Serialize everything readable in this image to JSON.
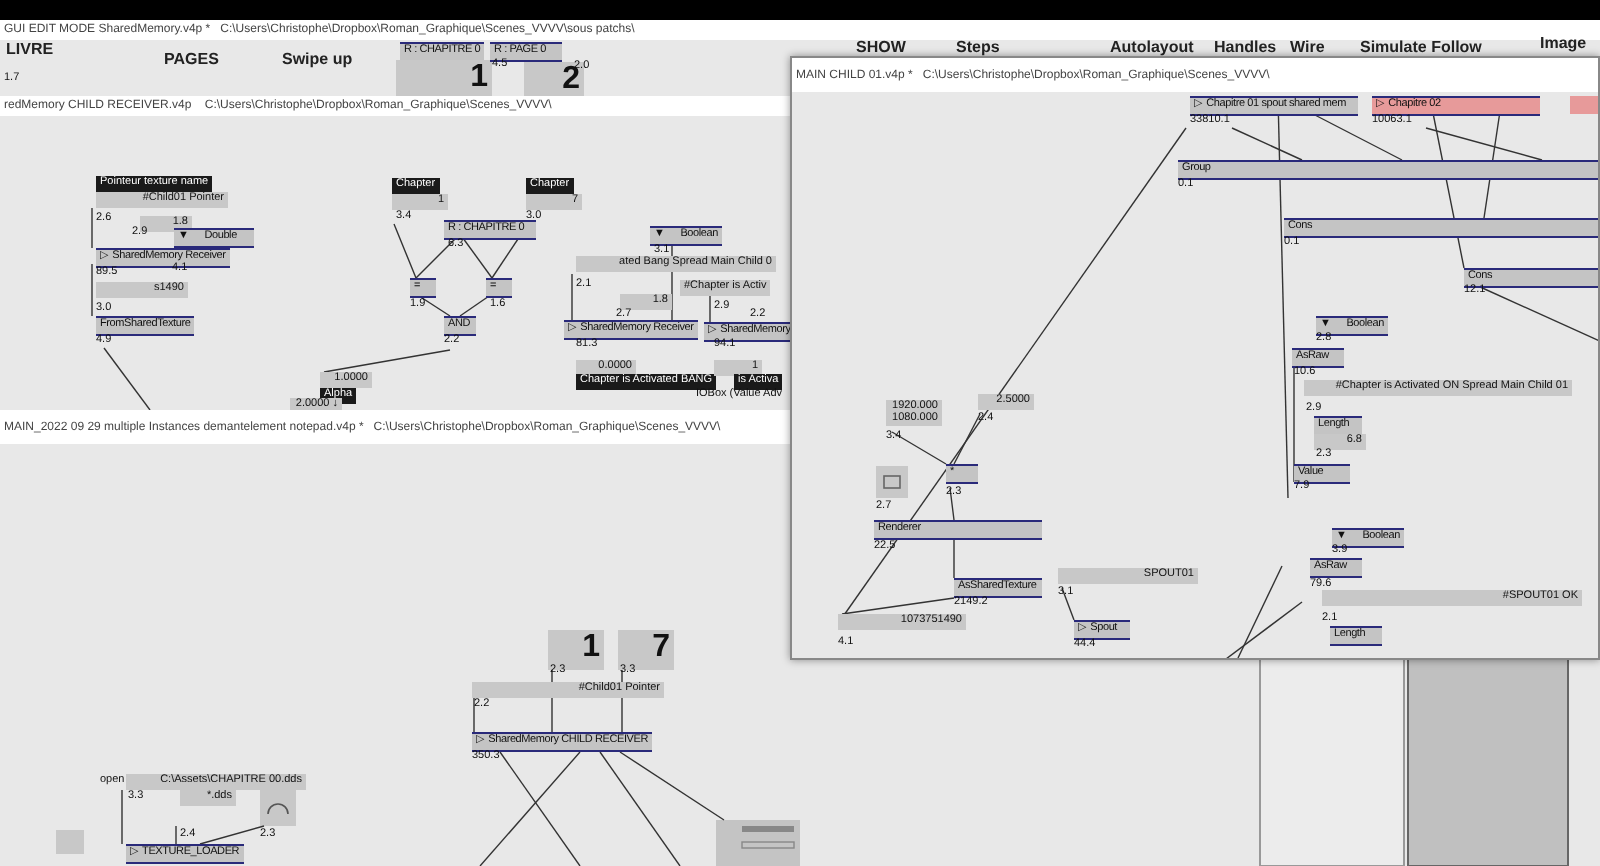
{
  "windows": [
    {
      "title": "GUI EDIT MODE SharedMemory.v4p *   C:\\Users\\Christophe\\Dropbox\\Roman_Graphique\\Scenes_VVVV\\sous patchs\\",
      "items": [
        {
          "kind": "button",
          "text": "LIVRE"
        },
        {
          "kind": "button",
          "text": "PAGES"
        },
        {
          "kind": "button",
          "text": "Swipe up"
        },
        {
          "kind": "node",
          "text": "R : CHAPITRE 0"
        },
        {
          "kind": "big",
          "text": "1"
        },
        {
          "kind": "node",
          "text": "R : PAGE 0"
        },
        {
          "kind": "value",
          "text": "4.5"
        },
        {
          "kind": "big",
          "text": "2"
        },
        {
          "kind": "value",
          "text": "2.0"
        },
        {
          "kind": "value",
          "text": "1.7"
        },
        {
          "kind": "button",
          "text": "SHOW"
        },
        {
          "kind": "button",
          "text": "Steps"
        },
        {
          "kind": "button",
          "text": "Autolayout"
        },
        {
          "kind": "button",
          "text": "Handles"
        },
        {
          "kind": "button",
          "text": "Wire"
        },
        {
          "kind": "button",
          "text": "Simulate Follow"
        },
        {
          "kind": "button",
          "text": "Image"
        }
      ]
    },
    {
      "title": "redMemory CHILD RECEIVER.v4p    C:\\Users\\Christophe\\Dropbox\\Roman_Graphique\\Scenes_VVVV\\",
      "items": [
        {
          "kind": "label",
          "text": "Pointeur texture name"
        },
        {
          "kind": "iobox",
          "text": "#Child01 Pointer"
        },
        {
          "kind": "value",
          "text": "2.6"
        },
        {
          "kind": "iobox",
          "text": "1.8"
        },
        {
          "kind": "value",
          "text": "2.9"
        },
        {
          "kind": "node",
          "text": "▼      Double"
        },
        {
          "kind": "node",
          "text": "▷ SharedMemory Receiver"
        },
        {
          "kind": "value",
          "text": "4.1"
        },
        {
          "kind": "value",
          "text": "89.5"
        },
        {
          "kind": "iobox",
          "text": "s1490"
        },
        {
          "kind": "value",
          "text": "3.0"
        },
        {
          "kind": "node",
          "text": "FromSharedTexture"
        },
        {
          "kind": "value",
          "text": "4.9"
        },
        {
          "kind": "label",
          "text": "Chapter"
        },
        {
          "kind": "iobox",
          "text": "1"
        },
        {
          "kind": "label",
          "text": "Chapter"
        },
        {
          "kind": "iobox",
          "text": "7"
        },
        {
          "kind": "value",
          "text": "3.4"
        },
        {
          "kind": "value",
          "text": "3.0"
        },
        {
          "kind": "node",
          "text": "R : CHAPITRE 0"
        },
        {
          "kind": "value",
          "text": "6.3"
        },
        {
          "kind": "node",
          "text": "="
        },
        {
          "kind": "node",
          "text": "="
        },
        {
          "kind": "value",
          "text": "1.9"
        },
        {
          "kind": "value",
          "text": "1.6"
        },
        {
          "kind": "node",
          "text": "AND"
        },
        {
          "kind": "value",
          "text": "2.2"
        },
        {
          "kind": "iobox",
          "text": "1.0000"
        },
        {
          "kind": "label",
          "text": "Alpha"
        },
        {
          "kind": "iobox",
          "text": "2.0000 ↓"
        },
        {
          "kind": "node",
          "text": "▼      Boolean"
        },
        {
          "kind": "value",
          "text": "3.1"
        },
        {
          "kind": "iobox",
          "text": "ated Bang Spread Main Child 0"
        },
        {
          "kind": "value",
          "text": "2.1"
        },
        {
          "kind": "iobox",
          "text": "1.8"
        },
        {
          "kind": "value",
          "text": "2.7"
        },
        {
          "kind": "node",
          "text": "▷ SharedMemory Receiver"
        },
        {
          "kind": "value",
          "text": "81.3"
        },
        {
          "kind": "iobox",
          "text": "0.0000"
        },
        {
          "kind": "label",
          "text": "Chapter is Activated BANG"
        },
        {
          "kind": "iobox",
          "text": "#Chapter is Activ"
        },
        {
          "kind": "value",
          "text": "2.9"
        },
        {
          "kind": "value",
          "text": "2.2"
        },
        {
          "kind": "node",
          "text": "▷ SharedMemory"
        },
        {
          "kind": "value",
          "text": "94.1"
        },
        {
          "kind": "iobox",
          "text": "1"
        },
        {
          "kind": "label",
          "text": "is Activa"
        },
        {
          "kind": "value",
          "text": "IOBox (Value Adv"
        }
      ]
    },
    {
      "title": "MAIN_2022 09 29 multiple Instances demantelement notepad.v4p *   C:\\Users\\Christophe\\Dropbox\\Roman_Graphique\\Scenes_VVVV\\",
      "items": [
        {
          "kind": "big",
          "text": "1"
        },
        {
          "kind": "big",
          "text": "7"
        },
        {
          "kind": "value",
          "text": "2.3"
        },
        {
          "kind": "value",
          "text": "3.3"
        },
        {
          "kind": "iobox",
          "text": "#Child01 Pointer"
        },
        {
          "kind": "value",
          "text": "2.2"
        },
        {
          "kind": "node",
          "text": "▷ SharedMemory CHILD RECEIVER"
        },
        {
          "kind": "value",
          "text": "350.3"
        },
        {
          "kind": "value",
          "text": "open"
        },
        {
          "kind": "iobox",
          "text": "C:\\Assets\\CHAPITRE 00.dds"
        },
        {
          "kind": "value",
          "text": "3.3"
        },
        {
          "kind": "iobox",
          "text": "*.dds"
        },
        {
          "kind": "value",
          "text": "2.4"
        },
        {
          "kind": "value",
          "text": "2.3"
        },
        {
          "kind": "node",
          "text": "▷ TEXTURE_LOADER"
        }
      ]
    },
    {
      "title": "MAIN CHILD 01.v4p *   C:\\Users\\Christophe\\Dropbox\\Roman_Graphique\\Scenes_VVVV\\",
      "items": [
        {
          "kind": "node",
          "text": "▷ Chapitre 01 spout shared mem"
        },
        {
          "kind": "value",
          "text": "33810.1"
        },
        {
          "kind": "errornode",
          "text": "▷ Chapitre 02"
        },
        {
          "kind": "value",
          "text": "10063.1"
        },
        {
          "kind": "node",
          "text": "Group"
        },
        {
          "kind": "value",
          "text": "0.1"
        },
        {
          "kind": "node",
          "text": "Cons"
        },
        {
          "kind": "value",
          "text": "0.1"
        },
        {
          "kind": "node",
          "text": "Cons"
        },
        {
          "kind": "value",
          "text": "12.1"
        },
        {
          "kind": "node",
          "text": "▼      Boolean"
        },
        {
          "kind": "value",
          "text": "2.8"
        },
        {
          "kind": "node",
          "text": "AsRaw"
        },
        {
          "kind": "value",
          "text": "10.6"
        },
        {
          "kind": "iobox",
          "text": "#Chapter is Activated ON Spread Main Child 01"
        },
        {
          "kind": "value",
          "text": "2.9"
        },
        {
          "kind": "node",
          "text": "Length"
        },
        {
          "kind": "iobox",
          "text": "6.8"
        },
        {
          "kind": "value",
          "text": "2.3"
        },
        {
          "kind": "node",
          "text": "Value"
        },
        {
          "kind": "value",
          "text": "7.9"
        },
        {
          "kind": "node",
          "text": "▼      Boolean"
        },
        {
          "kind": "value",
          "text": "3.9"
        },
        {
          "kind": "node",
          "text": "AsRaw"
        },
        {
          "kind": "value",
          "text": "79.6"
        },
        {
          "kind": "iobox",
          "text": "#SPOUT01 OK"
        },
        {
          "kind": "value",
          "text": "2.1"
        },
        {
          "kind": "node",
          "text": "Length"
        },
        {
          "kind": "iobox",
          "text": "1920.000\n1080.000"
        },
        {
          "kind": "value",
          "text": "3.4"
        },
        {
          "kind": "iobox",
          "text": "2.5000"
        },
        {
          "kind": "value",
          "text": "2.4"
        },
        {
          "kind": "node",
          "text": "*"
        },
        {
          "kind": "value",
          "text": "2.3"
        },
        {
          "kind": "value",
          "text": "2.7"
        },
        {
          "kind": "node",
          "text": "Renderer"
        },
        {
          "kind": "value",
          "text": "22.5"
        },
        {
          "kind": "node",
          "text": "AsSharedTexture"
        },
        {
          "kind": "value",
          "text": "2149.2"
        },
        {
          "kind": "iobox",
          "text": "1073751490"
        },
        {
          "kind": "value",
          "text": "4.1"
        },
        {
          "kind": "iobox",
          "text": "SPOUT01"
        },
        {
          "kind": "value",
          "text": "3.1"
        },
        {
          "kind": "node",
          "text": "▷ Spout"
        },
        {
          "kind": "value",
          "text": "44.4"
        }
      ]
    }
  ]
}
